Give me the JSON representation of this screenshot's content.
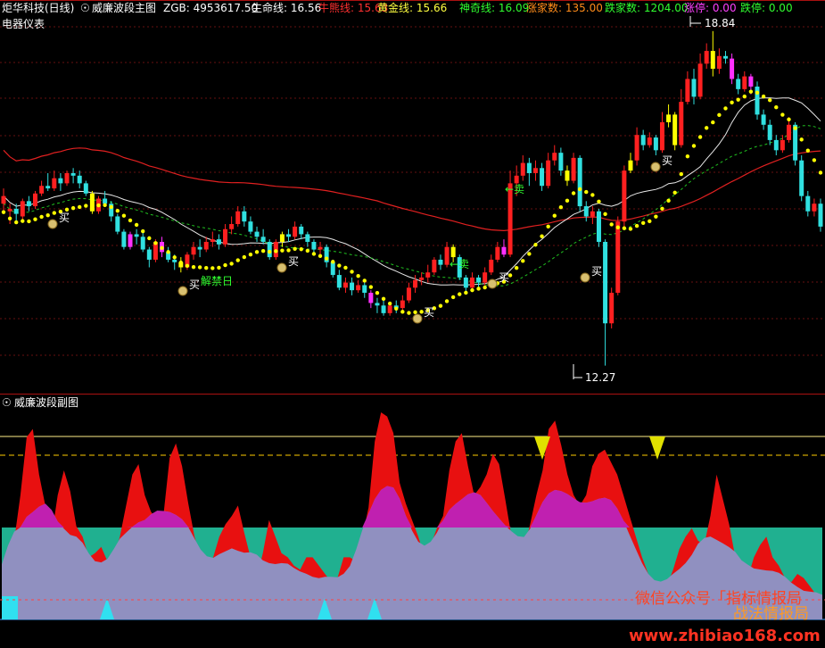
{
  "main_panel": {
    "stock_name": "炬华科技",
    "period": "(日线)",
    "indicator_name": "威廉波段主图",
    "sub_title": "电器仪表",
    "values": [
      {
        "label": "ZGB:",
        "value": "4953617.50",
        "color": "#ffffff"
      },
      {
        "label": "生命线:",
        "value": "16.56",
        "color": "#ffffff"
      },
      {
        "label": "牛熊线:",
        "value": "15.63",
        "color": "#ff3030"
      },
      {
        "label": "黄金线:",
        "value": "15.66",
        "color": "#ffff40"
      },
      {
        "label": "神奇线:",
        "value": "16.09",
        "color": "#30ff30"
      },
      {
        "label": "涨家数:",
        "value": "135.00",
        "color": "#ff8c1a"
      },
      {
        "label": "跌家数:",
        "value": "1204.00",
        "color": "#30ff30"
      },
      {
        "label": "涨停:",
        "value": "0.00",
        "color": "#ff40ff"
      },
      {
        "label": "跌停:",
        "value": "0.00",
        "color": "#30ff30"
      }
    ]
  },
  "sub_panel": {
    "indicator_name": "威廉波段副图"
  },
  "annotations": {
    "high_label": "18.84",
    "low_label": "12.27",
    "buy": "买",
    "sell": "←卖",
    "unlock": "解禁日"
  },
  "watermark": {
    "line1": "微信公众号「指标情报局",
    "line2": "战法情报局",
    "url": "www.zhibiao168.com"
  },
  "colors": {
    "up": "#ff2020",
    "down": "#30e0e0",
    "yellow": "#ffff00",
    "magenta": "#ff30ff",
    "teal": "#20b090",
    "purple": "#9090c0"
  },
  "chart_data": {
    "type": "candlestick",
    "y_range_main": [
      12.0,
      19.1
    ],
    "high": 18.84,
    "low": 12.27,
    "ohlc": [
      [
        15.45,
        15.6,
        15.3,
        15.75
      ],
      [
        15.3,
        15.35,
        15.05,
        15.45
      ],
      [
        15.35,
        15.25,
        15.05,
        15.45
      ],
      [
        15.2,
        15.5,
        15.1,
        15.55
      ],
      [
        15.5,
        15.4,
        15.3,
        15.6
      ],
      [
        15.4,
        15.65,
        15.35,
        15.7
      ],
      [
        15.65,
        15.8,
        15.6,
        15.9
      ],
      [
        15.8,
        15.75,
        15.7,
        16.05
      ],
      [
        15.75,
        15.95,
        15.7,
        16.1
      ],
      [
        15.95,
        15.85,
        15.7,
        16.05
      ],
      [
        15.85,
        16.05,
        15.8,
        16.1
      ],
      [
        16.05,
        16.0,
        15.85,
        16.15
      ],
      [
        16.0,
        15.85,
        15.75,
        16.1
      ],
      [
        15.85,
        15.65,
        15.6,
        15.9
      ],
      [
        15.65,
        15.3,
        15.25,
        15.7
      ],
      [
        15.3,
        15.55,
        15.25,
        15.6
      ],
      [
        15.55,
        15.45,
        15.4,
        15.7
      ],
      [
        15.45,
        15.2,
        15.1,
        15.5
      ],
      [
        15.2,
        14.9,
        14.85,
        15.25
      ],
      [
        14.9,
        14.6,
        14.55,
        14.95
      ],
      [
        14.6,
        14.85,
        14.55,
        14.9
      ],
      [
        14.85,
        14.8,
        14.65,
        14.95
      ],
      [
        14.8,
        14.55,
        14.5,
        14.9
      ],
      [
        14.55,
        14.35,
        14.2,
        14.6
      ],
      [
        14.35,
        14.7,
        14.3,
        14.75
      ],
      [
        14.7,
        14.5,
        14.4,
        14.8
      ],
      [
        14.5,
        14.35,
        14.3,
        14.6
      ],
      [
        14.35,
        14.3,
        14.15,
        14.45
      ],
      [
        14.3,
        14.2,
        14.1,
        14.4
      ],
      [
        14.2,
        14.45,
        14.15,
        14.5
      ],
      [
        14.45,
        14.6,
        14.35,
        14.7
      ],
      [
        14.6,
        14.55,
        14.4,
        14.75
      ],
      [
        14.55,
        14.7,
        14.5,
        14.8
      ],
      [
        14.7,
        14.75,
        14.6,
        14.9
      ],
      [
        14.75,
        14.65,
        14.55,
        14.85
      ],
      [
        14.65,
        14.95,
        14.6,
        15.05
      ],
      [
        14.95,
        15.05,
        14.85,
        15.2
      ],
      [
        15.05,
        15.3,
        15.0,
        15.4
      ],
      [
        15.3,
        15.1,
        15.0,
        15.4
      ],
      [
        15.1,
        14.9,
        14.85,
        15.2
      ],
      [
        14.9,
        14.8,
        14.7,
        15.0
      ],
      [
        14.8,
        14.7,
        14.65,
        14.95
      ],
      [
        14.7,
        14.4,
        14.35,
        14.75
      ],
      [
        14.4,
        14.7,
        14.35,
        14.75
      ],
      [
        14.7,
        14.85,
        14.6,
        14.9
      ],
      [
        14.85,
        14.8,
        14.7,
        14.95
      ],
      [
        14.8,
        15.0,
        14.75,
        15.1
      ],
      [
        15.0,
        14.85,
        14.75,
        15.05
      ],
      [
        14.85,
        14.7,
        14.6,
        14.9
      ],
      [
        14.7,
        14.55,
        14.45,
        14.75
      ],
      [
        14.55,
        14.6,
        14.45,
        14.7
      ],
      [
        14.6,
        14.3,
        14.2,
        14.65
      ],
      [
        14.3,
        14.05,
        14.0,
        14.35
      ],
      [
        14.05,
        13.8,
        13.75,
        14.15
      ],
      [
        13.8,
        13.9,
        13.7,
        14.0
      ],
      [
        13.9,
        13.75,
        13.65,
        14.0
      ],
      [
        13.75,
        13.85,
        13.7,
        13.95
      ],
      [
        13.85,
        13.7,
        13.6,
        13.95
      ],
      [
        13.7,
        13.5,
        13.4,
        13.75
      ],
      [
        13.5,
        13.45,
        13.3,
        13.6
      ],
      [
        13.45,
        13.3,
        13.25,
        13.55
      ],
      [
        13.3,
        13.45,
        13.25,
        13.5
      ],
      [
        13.45,
        13.4,
        13.3,
        13.55
      ],
      [
        13.4,
        13.55,
        13.35,
        13.65
      ],
      [
        13.55,
        13.8,
        13.5,
        13.9
      ],
      [
        13.8,
        13.95,
        13.7,
        14.05
      ],
      [
        13.95,
        14.0,
        13.85,
        14.1
      ],
      [
        14.0,
        14.1,
        13.9,
        14.25
      ],
      [
        14.1,
        14.35,
        14.05,
        14.4
      ],
      [
        14.35,
        14.25,
        14.15,
        14.45
      ],
      [
        14.25,
        14.6,
        14.2,
        14.7
      ],
      [
        14.6,
        14.4,
        14.3,
        14.65
      ],
      [
        14.4,
        14.0,
        13.95,
        14.45
      ],
      [
        14.0,
        13.8,
        13.7,
        14.05
      ],
      [
        13.8,
        14.0,
        13.75,
        14.1
      ],
      [
        14.0,
        13.9,
        13.8,
        14.05
      ],
      [
        13.9,
        14.1,
        13.85,
        14.2
      ],
      [
        14.1,
        14.35,
        14.05,
        14.45
      ],
      [
        14.35,
        14.6,
        14.3,
        14.7
      ],
      [
        14.6,
        14.45,
        14.4,
        14.75
      ],
      [
        14.45,
        15.85,
        14.4,
        16.1
      ],
      [
        15.85,
        16.0,
        15.6,
        16.2
      ],
      [
        16.0,
        16.25,
        15.9,
        16.4
      ],
      [
        16.25,
        16.05,
        15.8,
        16.35
      ],
      [
        16.05,
        16.15,
        15.9,
        16.3
      ],
      [
        16.15,
        15.8,
        15.7,
        16.25
      ],
      [
        15.8,
        16.3,
        15.75,
        16.45
      ],
      [
        16.3,
        16.45,
        16.2,
        16.6
      ],
      [
        16.45,
        16.1,
        16.0,
        16.55
      ],
      [
        16.1,
        15.9,
        15.8,
        16.2
      ],
      [
        15.9,
        16.35,
        15.85,
        16.45
      ],
      [
        16.35,
        15.4,
        15.3,
        16.4
      ],
      [
        15.4,
        15.2,
        15.1,
        15.5
      ],
      [
        15.2,
        15.3,
        15.05,
        15.4
      ],
      [
        15.3,
        14.7,
        14.6,
        15.35
      ],
      [
        14.7,
        13.1,
        12.27,
        14.75
      ],
      [
        13.1,
        13.7,
        13.0,
        13.8
      ],
      [
        13.7,
        15.1,
        13.65,
        15.2
      ],
      [
        15.1,
        16.1,
        15.0,
        16.2
      ],
      [
        16.1,
        16.3,
        16.05,
        16.45
      ],
      [
        16.3,
        16.8,
        16.2,
        16.95
      ],
      [
        16.8,
        16.6,
        16.5,
        16.9
      ],
      [
        16.6,
        16.75,
        16.55,
        16.85
      ],
      [
        16.75,
        16.5,
        16.4,
        16.8
      ],
      [
        16.5,
        17.05,
        16.45,
        17.25
      ],
      [
        17.05,
        17.2,
        16.95,
        17.4
      ],
      [
        17.2,
        16.6,
        16.5,
        17.25
      ],
      [
        16.6,
        17.45,
        16.55,
        17.7
      ],
      [
        17.45,
        17.9,
        17.4,
        18.05
      ],
      [
        17.9,
        17.55,
        17.4,
        18.1
      ],
      [
        17.55,
        18.2,
        17.5,
        18.4
      ],
      [
        18.2,
        18.45,
        18.1,
        18.6
      ],
      [
        18.45,
        18.1,
        17.95,
        18.84
      ],
      [
        18.1,
        18.35,
        18.0,
        18.5
      ],
      [
        18.35,
        18.3,
        18.2,
        18.45
      ],
      [
        18.3,
        17.9,
        17.8,
        18.4
      ],
      [
        17.9,
        17.7,
        17.6,
        18.0
      ],
      [
        17.7,
        17.95,
        17.65,
        18.05
      ],
      [
        17.95,
        17.75,
        17.6,
        18.0
      ],
      [
        17.75,
        17.2,
        17.1,
        17.85
      ],
      [
        17.2,
        17.0,
        16.9,
        17.3
      ],
      [
        17.0,
        16.7,
        16.6,
        17.1
      ],
      [
        16.7,
        16.5,
        16.4,
        16.8
      ],
      [
        16.5,
        16.7,
        16.45,
        16.8
      ],
      [
        16.7,
        17.0,
        16.65,
        17.15
      ],
      [
        17.0,
        16.3,
        16.2,
        17.05
      ],
      [
        16.3,
        15.6,
        15.5,
        16.4
      ],
      [
        15.6,
        15.3,
        15.2,
        15.7
      ],
      [
        15.3,
        15.45,
        15.2,
        15.55
      ],
      [
        15.45,
        15.0,
        14.9,
        15.55
      ]
    ],
    "candle_colors_note": "red=up, cyan=down, yellow/magenta=signal candles",
    "signal_candles": {
      "yellow": [
        14,
        28,
        44,
        71,
        89,
        99,
        105,
        106,
        112
      ],
      "magenta": [
        20,
        25,
        58,
        79,
        115,
        118
      ]
    },
    "lines": [
      "生命线",
      "牛熊线",
      "黄金线",
      "神奇线"
    ],
    "sub_range": [
      0,
      100
    ]
  }
}
